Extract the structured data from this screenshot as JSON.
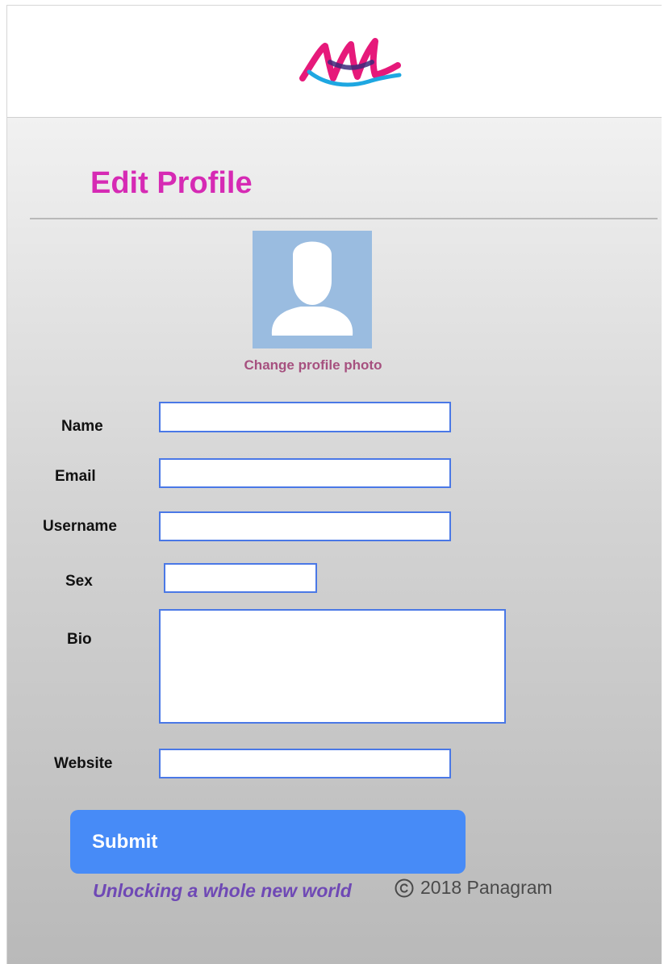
{
  "header": {
    "logo_icon": "brand-logo-icon",
    "logo_colors": [
      "#e6197a",
      "#1ea7e1",
      "#3b2a7a"
    ]
  },
  "page": {
    "title": "Edit Profile",
    "title_color": "#d62ab4"
  },
  "profile_photo": {
    "icon": "avatar-placeholder-icon",
    "change_label": "Change profile photo"
  },
  "form": {
    "fields": {
      "name": {
        "label": "Name",
        "value": "",
        "placeholder": ""
      },
      "email": {
        "label": "Email",
        "value": "",
        "placeholder": ""
      },
      "username": {
        "label": "Username",
        "value": "",
        "placeholder": ""
      },
      "sex": {
        "label": "Sex",
        "value": "",
        "placeholder": ""
      },
      "bio": {
        "label": "Bio",
        "value": "",
        "placeholder": ""
      },
      "website": {
        "label": "Website",
        "value": "",
        "placeholder": ""
      }
    },
    "submit_label": "Submit",
    "submit_color": "#478bf7"
  },
  "footer": {
    "tagline": "Unlocking a whole new world",
    "copyright_icon": "copyright-icon",
    "copyright_text": "2018 Panagram"
  }
}
